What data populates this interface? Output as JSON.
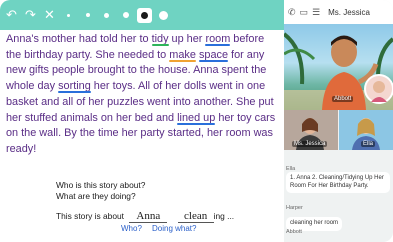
{
  "toolbar": {
    "colors": {
      "bar": "#6fd3c2",
      "story_text": "#5a2d86"
    },
    "tools": [
      {
        "name": "undo-icon",
        "glyph": "↶"
      },
      {
        "name": "redo-icon",
        "glyph": "↷"
      },
      {
        "name": "close-icon",
        "glyph": "✕"
      }
    ]
  },
  "story": {
    "segments": [
      {
        "t": "Anna's mother had told her to "
      },
      {
        "t": "tidy",
        "hl": "green"
      },
      {
        "t": " up her "
      },
      {
        "t": "room",
        "hl": "blue"
      },
      {
        "t": " before the birthday party. She needed to "
      },
      {
        "t": "make",
        "hl": "orange"
      },
      {
        "t": " "
      },
      {
        "t": "space",
        "hl": "blue"
      },
      {
        "t": " for any new gifts people brought to the house. Anna spent the whole day "
      },
      {
        "t": "sorting",
        "hl": "blue"
      },
      {
        "t": " her toys. All of her dolls went in one basket and all of her puzzles went into another. She put her stuffed animals on her bed and "
      },
      {
        "t": "lined up",
        "hl": "blue"
      },
      {
        "t": " her toy cars on the wall. By the time her party started, her room was ready!"
      }
    ]
  },
  "questions": {
    "q1": "Who is this story about?",
    "q2": "What are they doing?",
    "fill_prefix": "This story is about",
    "answer_who": "Anna",
    "answer_what": "clean",
    "fill_suffix": "ing ...",
    "hint_who": "Who?",
    "hint_what": "Doing what?"
  },
  "sidebar": {
    "header_name": "Ms. Jessica",
    "participants": {
      "main_label": "Abbott",
      "tile1_label": "Ms. Jessica",
      "tile2_label": "Ella"
    },
    "chat": [
      {
        "name": "Ella",
        "text": "1. Anna 2. Cleaning/Tidying Up Her Room For Her Birthday Party."
      },
      {
        "name": "Harper",
        "text": "cleaning her room"
      },
      {
        "name": "Abbott",
        "text": ""
      }
    ]
  }
}
